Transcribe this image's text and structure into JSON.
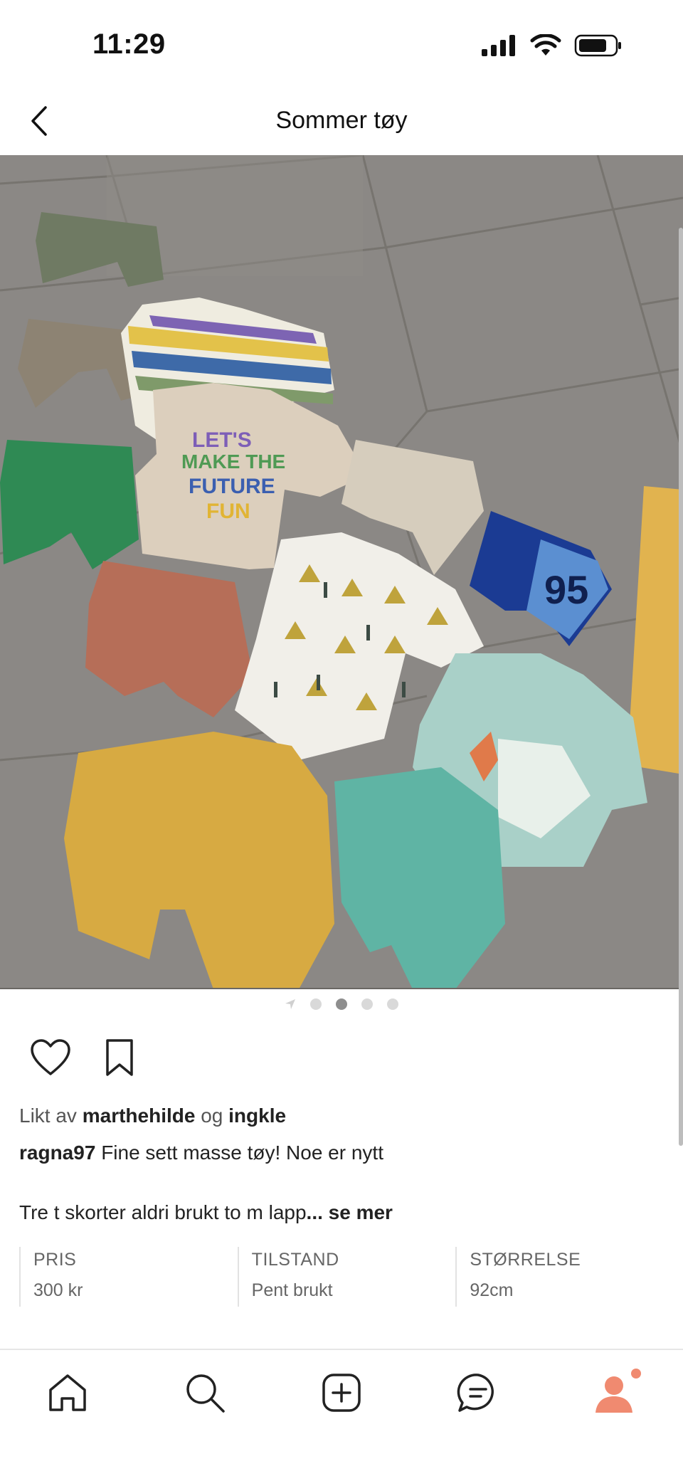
{
  "status_bar": {
    "time": "11:29"
  },
  "header": {
    "title": "Sommer tøy"
  },
  "carousel": {
    "total": 4,
    "active_index": 1
  },
  "likes": {
    "prefix": "Likt av",
    "user1": "marthehilde",
    "conj": "og",
    "user2": "ingkle"
  },
  "caption": {
    "username": "ragna97",
    "text": "Fine sett masse tøy! Noe er nytt",
    "line2": "Tre t skorter aldri brukt to m lapp",
    "more": "... se mer"
  },
  "details": [
    {
      "label": "PRIS",
      "value": "300 kr"
    },
    {
      "label": "TILSTAND",
      "value": "Pent brukt"
    },
    {
      "label": "STØRRELSE",
      "value": "92cm"
    }
  ],
  "photo": {
    "print_text_1": "LET'S",
    "print_text_2": "MAKE THE",
    "print_text_3": "FUTURE",
    "print_text_4": "FUN",
    "shorts_number": "95"
  },
  "colors": {
    "accent": "#f08a70",
    "icon": "#222222"
  }
}
